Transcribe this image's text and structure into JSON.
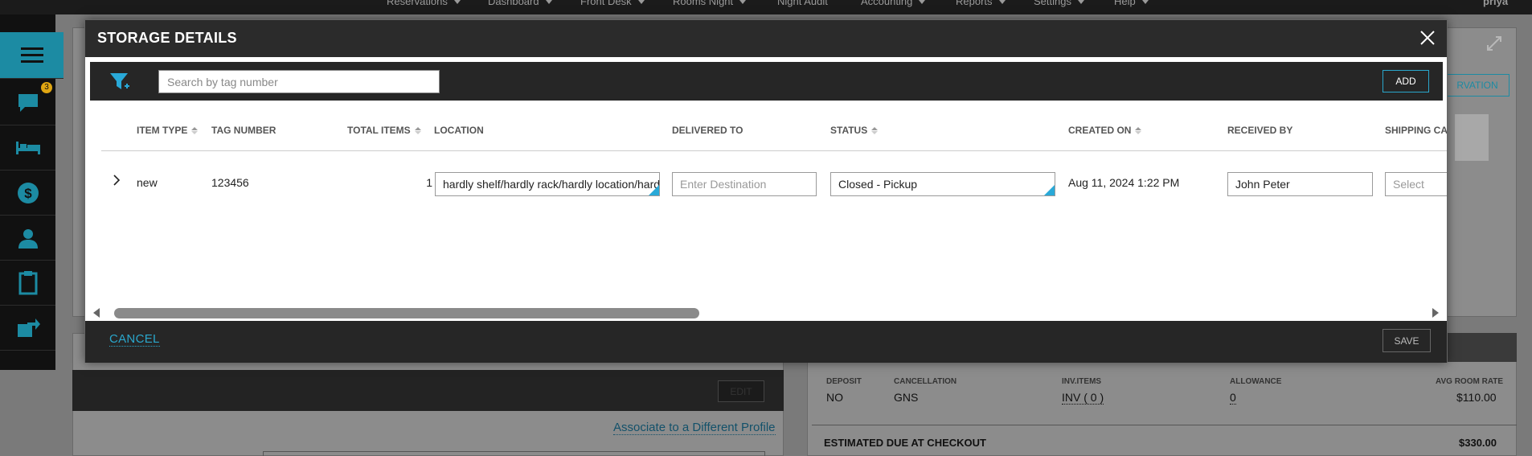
{
  "nav": {
    "items": [
      "Reservations",
      "Dashboard",
      "Front Desk",
      "Rooms Night",
      "Night Audit",
      "Accounting",
      "Reports",
      "Settings",
      "Help"
    ],
    "user": "priya"
  },
  "sidebar": {
    "badge_count": "3"
  },
  "background": {
    "edit_label": "EDIT",
    "reservation_label": "RVATION",
    "associate_link": "Associate to a Different Profile",
    "summary": {
      "deposit_label": "DEPOSIT",
      "deposit_value": "NO",
      "cancellation_label": "CANCELLATION",
      "cancellation_value": "GNS",
      "inv_label": "INV.ITEMS",
      "inv_value": "INV ( 0 )",
      "allowance_label": "ALLOWANCE",
      "allowance_value": "0",
      "rate_label": "AVG ROOM RATE",
      "rate_value": "$110.00",
      "due_label": "ESTIMATED DUE AT CHECKOUT",
      "due_value": "$330.00"
    }
  },
  "modal": {
    "title": "STORAGE DETAILS",
    "search_placeholder": "Search by tag number",
    "add_label": "ADD",
    "columns": {
      "item_type": "ITEM TYPE",
      "tag_number": "TAG NUMBER",
      "total_items": "TOTAL ITEMS",
      "location": "LOCATION",
      "delivered_to": "DELIVERED TO",
      "status": "STATUS",
      "created_on": "CREATED ON",
      "received_by": "RECEIVED BY",
      "shipping": "SHIPPING CA"
    },
    "row": {
      "item_type": "new",
      "tag_number": "123456",
      "total_items": "1",
      "location": "hardly shelf/hardly rack/hardly location/hardly",
      "delivered_placeholder": "Enter Destination",
      "status": "Closed - Pickup",
      "created_on": "Aug 11, 2024 1:22 PM",
      "received_by": "John Peter",
      "shipping_placeholder": "Select"
    },
    "cancel_label": "CANCEL",
    "save_label": "SAVE"
  },
  "colors": {
    "accent": "#29a9d8",
    "header": "#2b2b2b",
    "toolbar": "#262626"
  }
}
